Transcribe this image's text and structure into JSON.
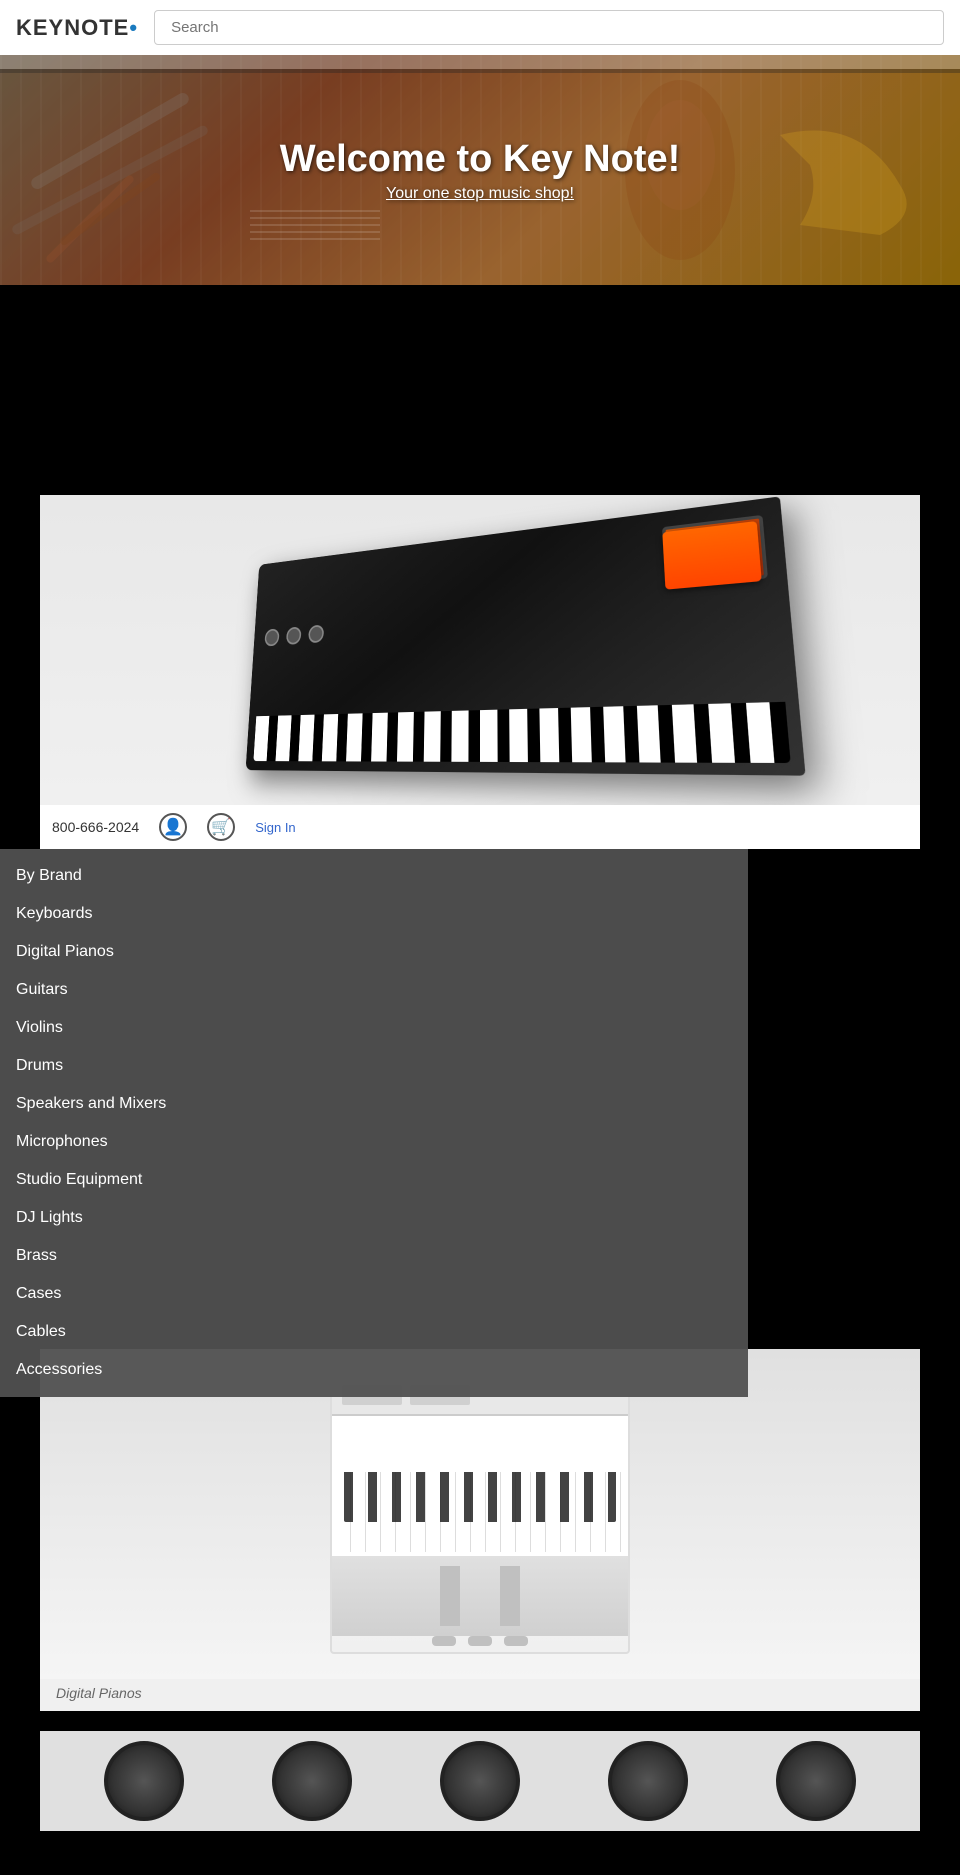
{
  "header": {
    "logo_text": "KEYNOTE",
    "logo_suffix": "•",
    "search_placeholder": "Search"
  },
  "hero": {
    "title": "Welcome to Key Note!",
    "subtitle": "Your one stop music shop!"
  },
  "contact": {
    "phone": "800-666-2024",
    "signin_label": "Sign In"
  },
  "nav_menu": {
    "items": [
      {
        "id": "by-brand",
        "label": "By Brand"
      },
      {
        "id": "keyboards",
        "label": "Keyboards"
      },
      {
        "id": "digital-pianos",
        "label": "Digital Pianos"
      },
      {
        "id": "guitars",
        "label": "Guitars"
      },
      {
        "id": "violins",
        "label": "Violins"
      },
      {
        "id": "drums",
        "label": "Drums"
      },
      {
        "id": "speakers-mixers",
        "label": "Speakers and Mixers"
      },
      {
        "id": "microphones",
        "label": "Microphones"
      },
      {
        "id": "studio-equipment",
        "label": "Studio Equipment"
      },
      {
        "id": "dj-lights",
        "label": "DJ Lights"
      },
      {
        "id": "brass",
        "label": "Brass"
      },
      {
        "id": "cases",
        "label": "Cases"
      },
      {
        "id": "cables",
        "label": "Cables"
      },
      {
        "id": "accessories",
        "label": "Accessories"
      }
    ]
  },
  "products": {
    "digital_pianos_label": "Digital Pianos"
  }
}
